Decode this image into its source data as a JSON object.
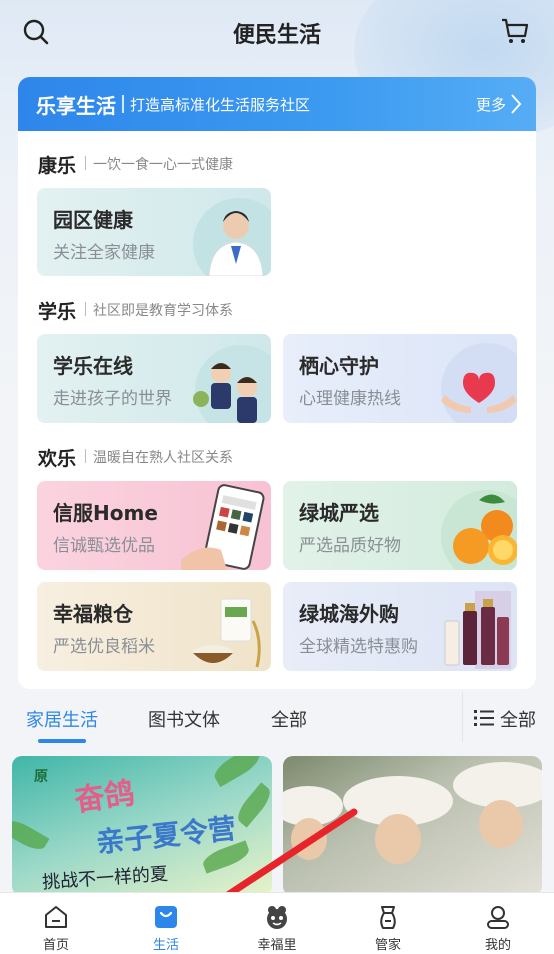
{
  "header": {
    "title": "便民生活",
    "search_icon": "search-icon",
    "cart_icon": "cart-icon"
  },
  "banner": {
    "title": "乐享生活",
    "subtitle": "打造高标准化生活服务社区",
    "more": "更多"
  },
  "sections": [
    {
      "title": "康乐",
      "subtitle": "一饮一食一心一式健康",
      "tiles": [
        {
          "title": "园区健康",
          "subtitle": "关注全家健康",
          "icon": "doctor-image"
        }
      ]
    },
    {
      "title": "学乐",
      "subtitle": "社区即是教育学习体系",
      "tiles": [
        {
          "title": "学乐在线",
          "subtitle": "走进孩子的世界",
          "icon": "children-image"
        },
        {
          "title": "栖心守护",
          "subtitle": "心理健康热线",
          "icon": "heart-hands-image"
        }
      ]
    },
    {
      "title": "欢乐",
      "subtitle": "温暖自在熟人社区关系",
      "tiles": [
        {
          "title": "信服Home",
          "subtitle": "信诚甄选优品",
          "icon": "phone-shop-image"
        },
        {
          "title": "绿城严选",
          "subtitle": "严选品质好物",
          "icon": "oranges-image"
        },
        {
          "title": "幸福粮仓",
          "subtitle": "严选优良稻米",
          "icon": "rice-image"
        },
        {
          "title": "绿城海外购",
          "subtitle": "全球精选特惠购",
          "icon": "cosmetics-image"
        }
      ]
    }
  ],
  "tabs": {
    "items": [
      "家居生活",
      "图书文体",
      "全部"
    ],
    "active": "家居生活",
    "all_label": "全部"
  },
  "feed": [
    {
      "logo": "原",
      "headline1": "奋鸽",
      "headline2": "亲子夏令营",
      "caption": "挑战不一样的夏",
      "image": "summer-camp-poster"
    },
    {
      "image": "kids-with-hats-photo"
    }
  ],
  "navbar": {
    "items": [
      {
        "label": "首页",
        "icon": "home-icon"
      },
      {
        "label": "生活",
        "icon": "shopping-bag-icon"
      },
      {
        "label": "幸福里",
        "icon": "community-icon"
      },
      {
        "label": "管家",
        "icon": "butler-icon"
      },
      {
        "label": "我的",
        "icon": "profile-icon"
      }
    ],
    "active": "生活"
  },
  "colors": {
    "accent": "#2e86ea",
    "arrow": "#e8242b"
  }
}
